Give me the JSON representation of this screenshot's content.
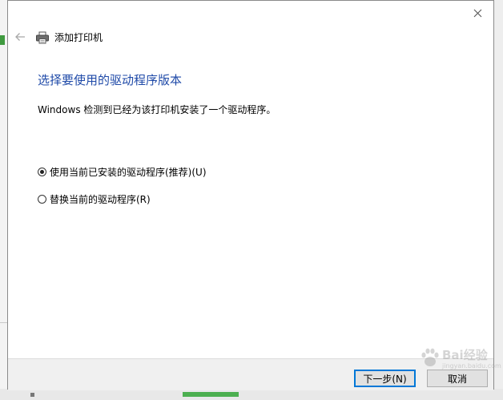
{
  "window": {
    "title": "添加打印机"
  },
  "page": {
    "heading": "选择要使用的驱动程序版本",
    "description": "Windows 检测到已经为该打印机安装了一个驱动程序。"
  },
  "options": [
    {
      "label": "使用当前已安装的驱动程序(推荐)(U)",
      "checked": true
    },
    {
      "label": "替换当前的驱动程序(R)",
      "checked": false
    }
  ],
  "buttons": {
    "next": "下一步(N)",
    "cancel": "取消"
  },
  "watermark": {
    "text": "Bai经验",
    "sub": "jingyan.baidu.com"
  },
  "icons": {
    "close": "close-icon",
    "back": "back-arrow-icon",
    "printer": "printer-icon"
  },
  "colors": {
    "heading": "#1f4aa8",
    "accent": "#0078d7",
    "footer_bg": "#f0f0f0"
  }
}
